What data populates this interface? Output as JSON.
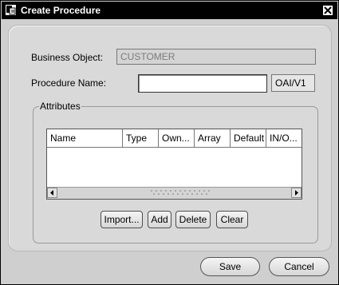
{
  "window": {
    "title": "Create Procedure"
  },
  "form": {
    "business_object_label": "Business Object:",
    "business_object_value": "CUSTOMER",
    "procedure_name_label": "Procedure Name:",
    "procedure_name_value": "",
    "namespace_value": "OAI/V1"
  },
  "attributes": {
    "group_label": "Attributes",
    "columns": [
      "Name",
      "Type",
      "Own...",
      "Array",
      "Default",
      "IN/O..."
    ],
    "rows": []
  },
  "attribute_buttons": {
    "import": "Import...",
    "add": "Add",
    "delete": "Delete",
    "clear": "Clear"
  },
  "footer": {
    "save": "Save",
    "cancel": "Cancel"
  }
}
